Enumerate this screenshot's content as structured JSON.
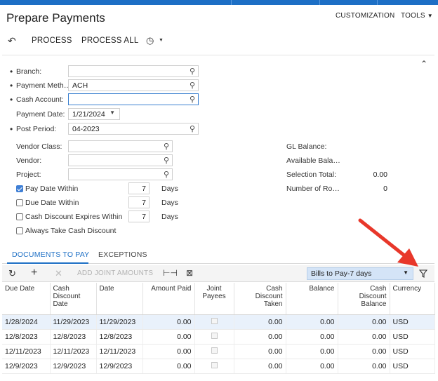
{
  "header": {
    "title": "Prepare Payments",
    "customization": "CUSTOMIZATION",
    "tools": "TOOLS"
  },
  "toolbar": {
    "process": "PROCESS",
    "process_all": "PROCESS ALL"
  },
  "form": {
    "branch_label": "Branch:",
    "branch_value": "",
    "payment_method_label": "Payment Meth…",
    "payment_method_value": "ACH",
    "cash_account_label": "Cash Account:",
    "cash_account_value": "",
    "payment_date_label": "Payment Date:",
    "payment_date_value": "1/21/2024",
    "post_period_label": "Post Period:",
    "post_period_value": "04-2023",
    "vendor_class_label": "Vendor Class:",
    "vendor_label": "Vendor:",
    "project_label": "Project:",
    "pay_date_within_label": "Pay Date Within",
    "pay_date_within_value": "7",
    "due_date_within_label": "Due Date Within",
    "due_date_within_value": "7",
    "cash_discount_label": "Cash Discount Expires Within",
    "cash_discount_value": "7",
    "days": "Days",
    "always_take_label": "Always Take Cash Discount",
    "pay_date_within_checked": true,
    "due_date_within_checked": false,
    "cash_discount_checked": false,
    "always_take_checked": false
  },
  "summary": {
    "gl_balance_label": "GL Balance:",
    "gl_balance_value": "",
    "available_balance_label": "Available Bala…",
    "available_balance_value": "",
    "selection_total_label": "Selection Total:",
    "selection_total_value": "0.00",
    "number_of_rows_label": "Number of Ro…",
    "number_of_rows_value": "0"
  },
  "tabs": {
    "documents_to_pay": "DOCUMENTS TO PAY",
    "exceptions": "EXCEPTIONS"
  },
  "grid_toolbar": {
    "add_joint_amounts": "ADD JOINT AMOUNTS",
    "filter_value": "Bills to Pay-7 days"
  },
  "grid": {
    "columns": [
      "Due Date",
      "Cash Discount Date",
      "Date",
      "Amount Paid",
      "Joint Payees",
      "Cash Discount Taken",
      "Balance",
      "Cash Discount Balance",
      "Currency"
    ],
    "rows": [
      [
        "1/28/2024",
        "11/29/2023",
        "11/29/2023",
        "0.00",
        "",
        "0.00",
        "0.00",
        "0.00",
        "USD"
      ],
      [
        "12/8/2023",
        "12/8/2023",
        "12/8/2023",
        "0.00",
        "",
        "0.00",
        "0.00",
        "0.00",
        "USD"
      ],
      [
        "12/11/2023",
        "12/11/2023",
        "12/11/2023",
        "0.00",
        "",
        "0.00",
        "0.00",
        "0.00",
        "USD"
      ],
      [
        "12/9/2023",
        "12/9/2023",
        "12/9/2023",
        "0.00",
        "",
        "0.00",
        "0.00",
        "0.00",
        "USD"
      ]
    ]
  },
  "colors": {
    "accent": "#1d6fc5",
    "annotation_arrow": "#e8372a"
  }
}
